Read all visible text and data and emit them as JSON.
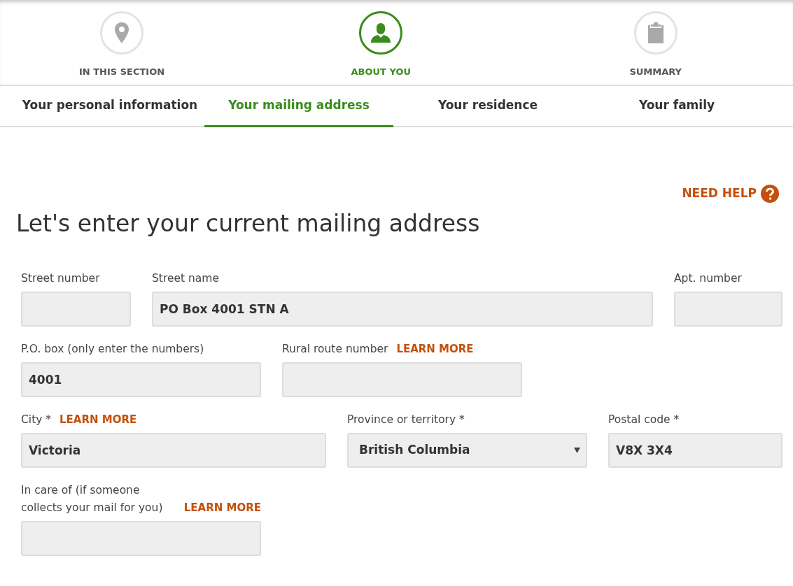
{
  "steps": [
    {
      "label": "IN THIS SECTION",
      "selected": false
    },
    {
      "label": "ABOUT YOU",
      "selected": true
    },
    {
      "label": "SUMMARY",
      "selected": false
    }
  ],
  "tabs": [
    {
      "label": "Your personal information",
      "selected": false
    },
    {
      "label": "Your mailing address",
      "selected": true
    },
    {
      "label": "Your residence",
      "selected": false
    },
    {
      "label": "Your family",
      "selected": false
    }
  ],
  "help": {
    "label": "NEED HELP"
  },
  "title": "Let's enter your current mailing address",
  "rows": [
    {
      "fields": [
        {
          "kind": "text",
          "label": "Street number"
        },
        {
          "kind": "text",
          "label": "Street name",
          "value": "PO Box 4001 STN A"
        },
        {
          "kind": "text",
          "label": "Apt. number"
        }
      ]
    },
    {
      "fields": [
        {
          "kind": "text",
          "label": "P.O. box (only enter the numbers)",
          "value": "4001"
        },
        {
          "kind": "text",
          "label": "Rural route number",
          "learn_more": "LEARN MORE"
        }
      ]
    },
    {
      "fields": [
        {
          "kind": "text",
          "label": "City *",
          "learn_more": "LEARN MORE",
          "value": "Victoria"
        },
        {
          "kind": "select",
          "label": "Province or territory *",
          "value": "British Columbia"
        },
        {
          "kind": "text",
          "label": "Postal code *",
          "value": "V8X 3X4"
        }
      ]
    },
    {
      "fields": [
        {
          "kind": "text",
          "label": "In care of (if someone collects your mail for you)",
          "learn_more": "LEARN MORE"
        }
      ]
    }
  ]
}
